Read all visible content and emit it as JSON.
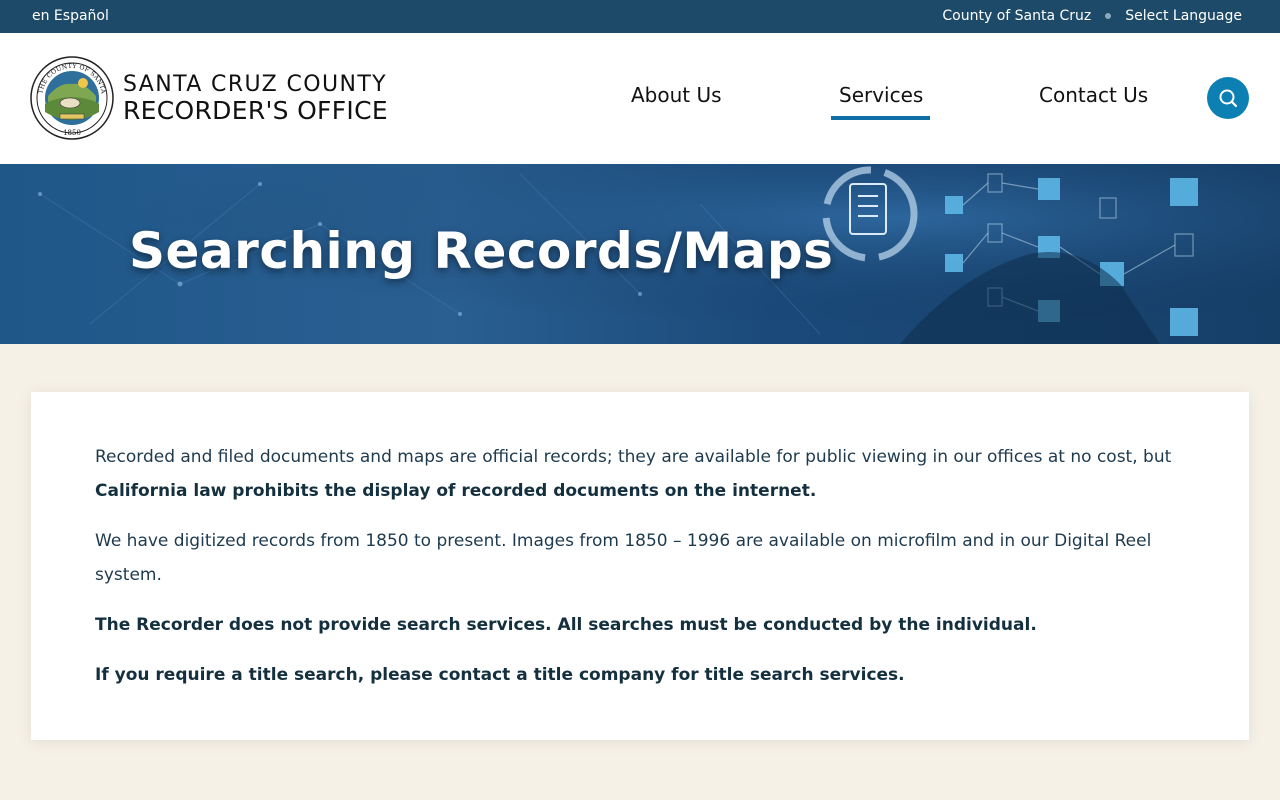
{
  "topbar": {
    "language_link": "en Español",
    "county_link": "County of Santa Cruz",
    "select_language": "Select Language"
  },
  "header": {
    "brand_line1": "SANTA CRUZ COUNTY",
    "brand_line2": "RECORDER'S OFFICE",
    "seal_text_top": "THE COUNTY OF SANTA CRUZ",
    "seal_year": "1850",
    "nav": {
      "about": "About Us",
      "services": "Services",
      "contact": "Contact Us",
      "active": "Services"
    },
    "search_icon": "search-icon"
  },
  "banner": {
    "title": "Searching Records/Maps"
  },
  "content": {
    "p1_text": "Recorded and filed documents and maps are official records; they are available for public viewing in our offices at no cost, but ",
    "p1_bold": "California law prohibits the display of recorded documents on the internet.",
    "p2": "We have digitized records from 1850 to present. Images from 1850 – 1996 are available on microfilm and in our Digital Reel system.",
    "p3": "The Recorder does not provide search services. All searches must be conducted by the individual.",
    "p4": "If you require a title search, please contact a title company for title search services."
  },
  "colors": {
    "topbar": "#1d4a68",
    "accent": "#0f6ea5",
    "search_button": "#0c7fb3",
    "page_background": "#f6f1e6"
  }
}
